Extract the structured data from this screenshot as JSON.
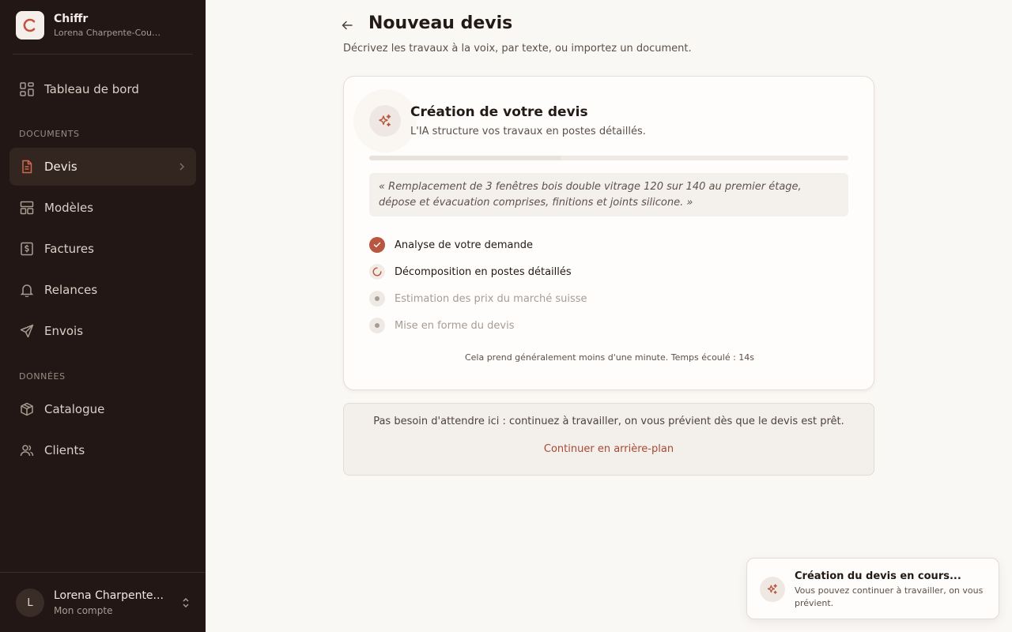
{
  "brand": {
    "name": "Chiffr",
    "subtitle": "Lorena Charpente-Couve..."
  },
  "sidebar": {
    "dashboard": "Tableau de bord",
    "section_documents": "DOCUMENTS",
    "devis": "Devis",
    "modeles": "Modèles",
    "factures": "Factures",
    "relances": "Relances",
    "envois": "Envois",
    "section_donnees": "DONNÉES",
    "catalogue": "Catalogue",
    "clients": "Clients"
  },
  "account": {
    "initial": "L",
    "name": "Lorena Charpente...",
    "sub": "Mon compte"
  },
  "page": {
    "title": "Nouveau devis",
    "subtitle": "Décrivez les travaux à la voix, par texte, ou importez un document."
  },
  "card": {
    "title": "Création de votre devis",
    "subtitle": "L'IA structure vos travaux en postes détaillés.",
    "progress": 0.4,
    "quote": "« Remplacement de 3 fenêtres bois double vitrage 120 sur 140 au premier étage, dépose et évacuation comprises, finitions et joints silicone. »",
    "steps": [
      {
        "label": "Analyse de votre demande",
        "status": "done"
      },
      {
        "label": "Décomposition en postes détaillés",
        "status": "running"
      },
      {
        "label": "Estimation des prix du marché suisse",
        "status": "pending"
      },
      {
        "label": "Mise en forme du devis",
        "status": "pending"
      }
    ],
    "elapsed": "Cela prend généralement moins d'une minute. Temps écoulé : 14s"
  },
  "notice": {
    "text": "Pas besoin d'attendre ici : continuez à travailler, on vous prévient dès que le devis est prêt.",
    "link": "Continuer en arrière-plan"
  },
  "toast": {
    "title": "Création du devis en cours...",
    "body": "Vous pouvez continuer à travailler, on vous prévient."
  },
  "colors": {
    "accent": "#b85640",
    "sidebar_bg": "#221714",
    "page_bg": "#faf8f5"
  }
}
